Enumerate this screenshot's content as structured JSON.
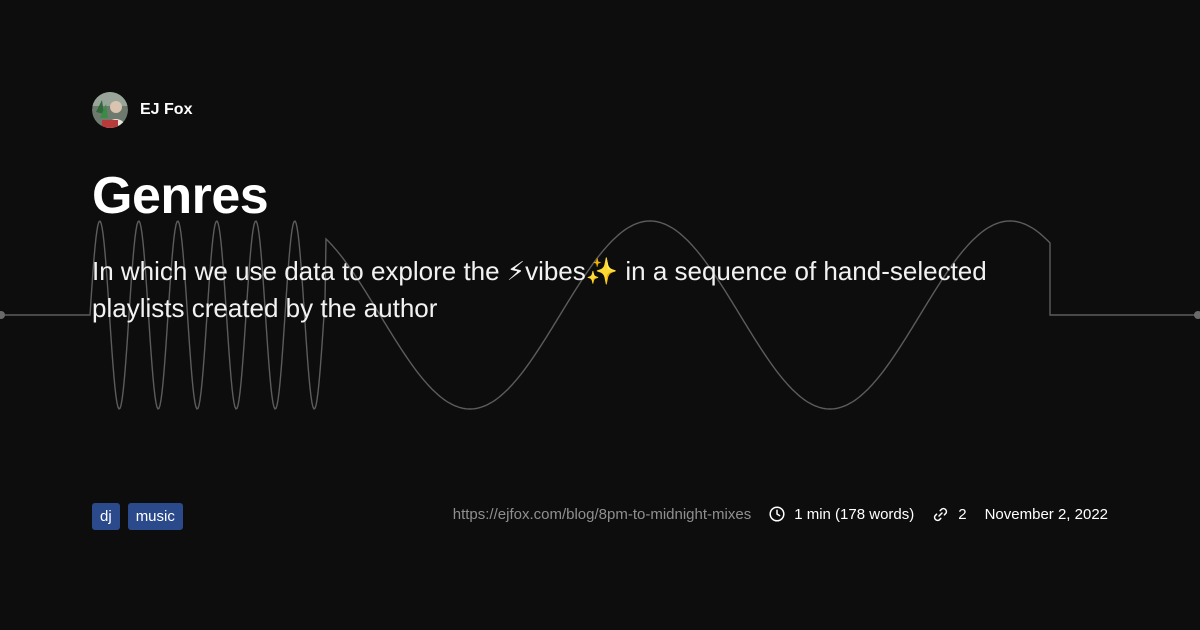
{
  "author": {
    "name": "EJ Fox",
    "avatar_icon": "author-avatar"
  },
  "post": {
    "title": "Genres",
    "description": "In which we use data to explore the ⚡vibes✨ in a sequence of hand-selected playlists created by the author"
  },
  "tags": [
    "dj",
    "music"
  ],
  "meta": {
    "url": "https://ejfox.com/blog/8pm-to-midnight-mixes",
    "reading_time": "1 min (178 words)",
    "reading_time_icon": "clock-icon",
    "links_count": "2",
    "links_icon": "link-icon",
    "date": "November 2, 2022"
  },
  "colors": {
    "background": "#0d0d0d",
    "tag_background": "#2a4a8c",
    "wave_stroke": "#5c5c5c",
    "url_text": "#8f8f8f"
  }
}
